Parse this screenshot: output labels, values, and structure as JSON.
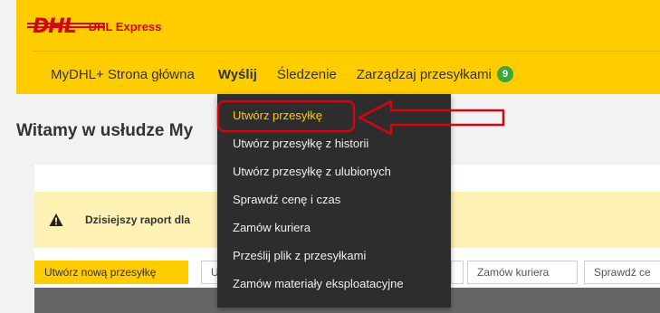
{
  "brand": {
    "logo_text": "DHL",
    "product": "DHL Express"
  },
  "nav": {
    "items": [
      {
        "label": "MyDHL+ Strona główna"
      },
      {
        "label": "Wyślij"
      },
      {
        "label": "Śledzenie"
      },
      {
        "label": "Zarządzaj przesyłkami",
        "badge": "9"
      }
    ]
  },
  "page": {
    "title": "Witamy w usłudze My"
  },
  "alert": {
    "icon": "warning-icon",
    "text": "Dzisiejszy raport dla"
  },
  "tabs": [
    {
      "label": "Utwórz nową przesyłkę"
    },
    {
      "label": "U"
    },
    {
      "label": ""
    },
    {
      "label": "Zamów kuriera"
    },
    {
      "label": "Sprawdź ce"
    }
  ],
  "dropdown": {
    "items": [
      {
        "label": "Utwórz przesyłkę"
      },
      {
        "label": "Utwórz przesyłkę z historii"
      },
      {
        "label": "Utwórz przesyłkę z ulubionych"
      },
      {
        "label": "Sprawdź cenę i czas"
      },
      {
        "label": "Zamów kuriera"
      },
      {
        "label": "Prześlij plik z przesyłkami"
      },
      {
        "label": "Zamów materiały eksploatacyjne"
      }
    ]
  },
  "colors": {
    "brand_yellow": "#ffcc00",
    "brand_red": "#d40511",
    "annotation_red": "#d40511",
    "badge_green": "#3ba73b"
  }
}
